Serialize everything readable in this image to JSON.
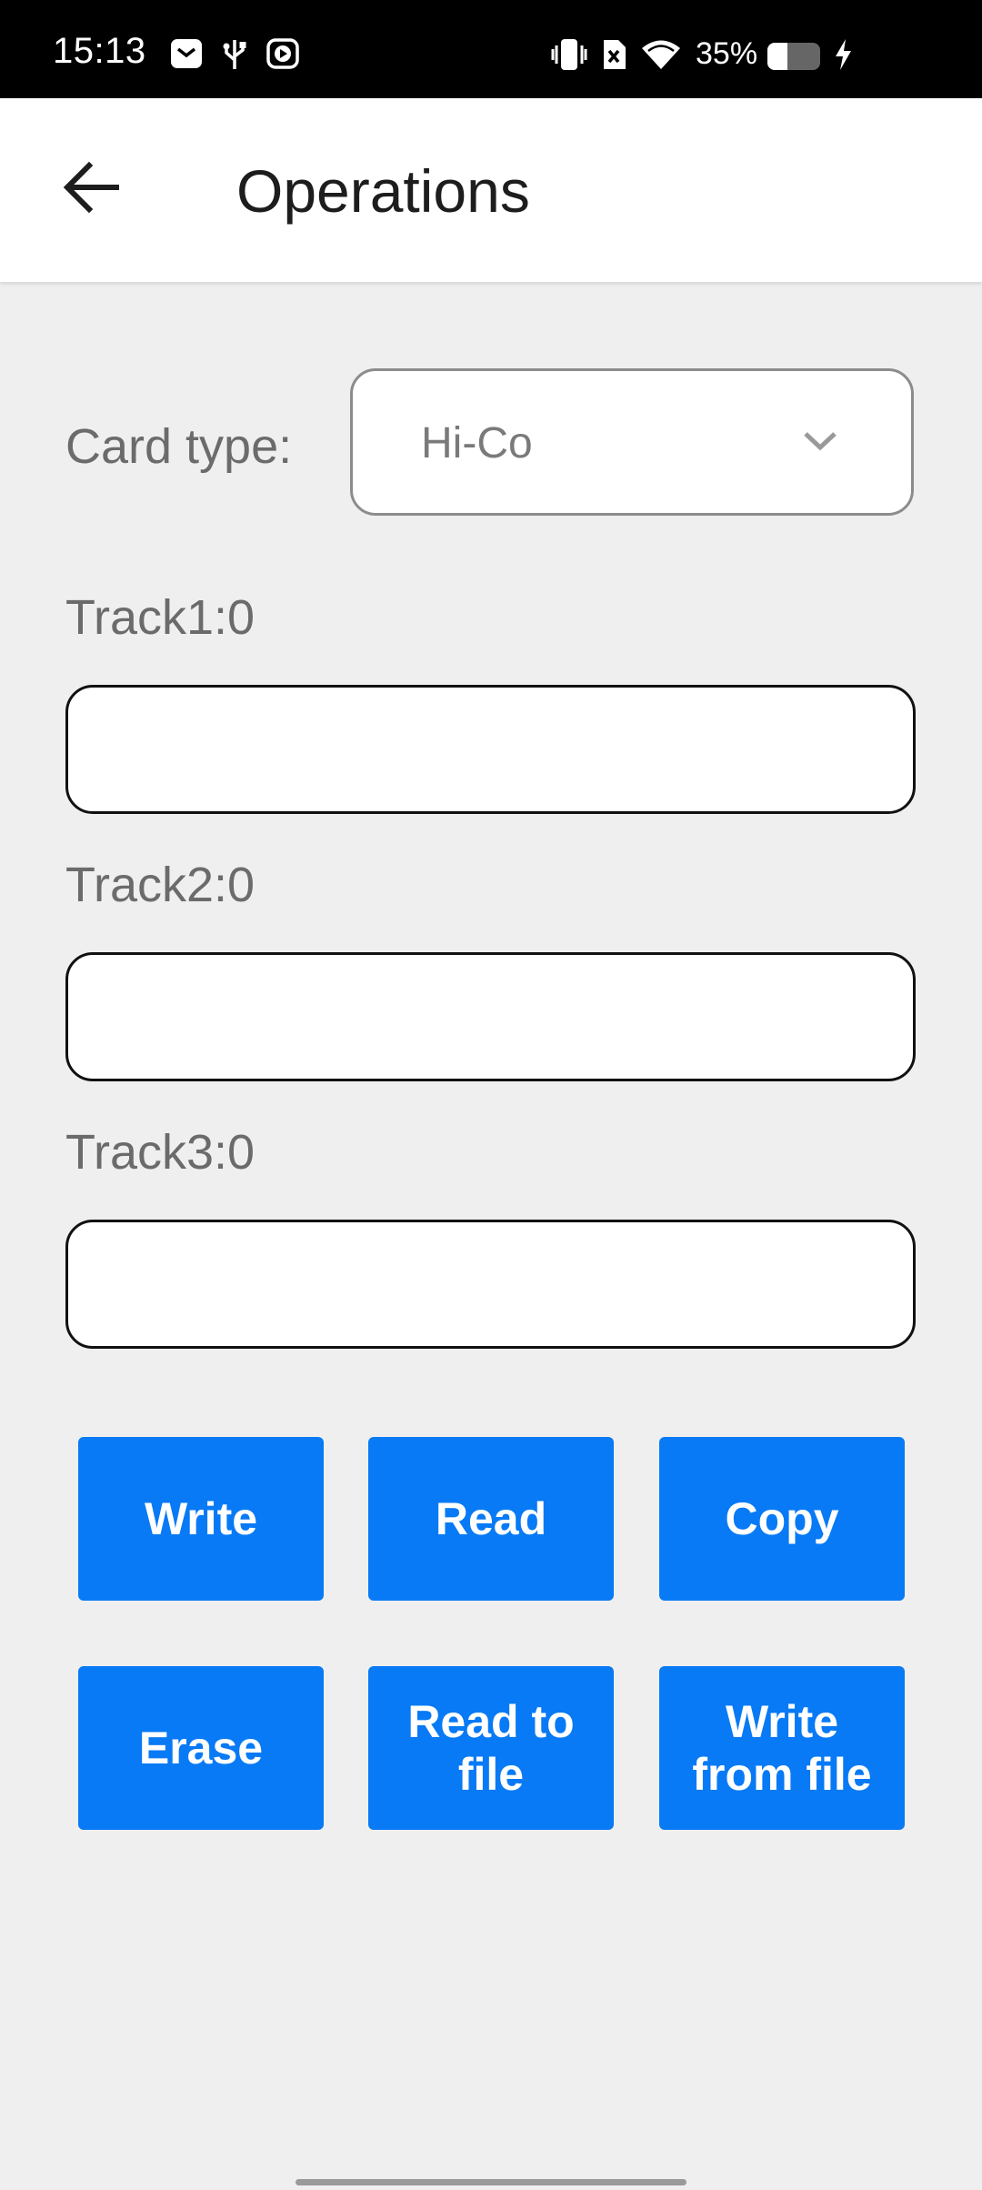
{
  "status_bar": {
    "time": "15:13",
    "battery": "35%",
    "icons": [
      "messages-icon",
      "usb-icon",
      "media-icon",
      "vibrate-icon",
      "no-sim-icon",
      "wifi-icon",
      "battery-icon",
      "charging-icon"
    ]
  },
  "header": {
    "title": "Operations",
    "back_icon": "arrow-left-icon"
  },
  "form": {
    "card_type_label": "Card type:",
    "card_type_value": "Hi-Co",
    "track1_label": "Track1:0",
    "track1_value": "",
    "track2_label": "Track2:0",
    "track2_value": "",
    "track3_label": "Track3:0",
    "track3_value": ""
  },
  "buttons": {
    "write": "Write",
    "read": "Read",
    "copy": "Copy",
    "erase": "Erase",
    "read_to_file": "Read to\nfile",
    "write_from_file": "Write\nfrom file"
  },
  "colors": {
    "accent": "#087af5",
    "background": "#efefef"
  }
}
